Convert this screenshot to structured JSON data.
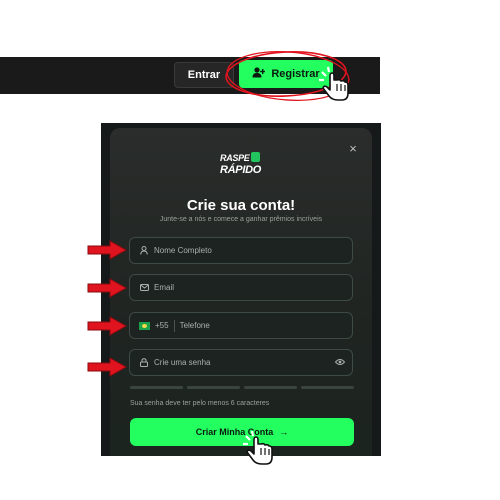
{
  "header": {
    "login_label": "Entrar",
    "register_label": "Registrar"
  },
  "modal": {
    "logo_line1": "RASPE",
    "logo_line2": "RÁPIDO",
    "close_symbol": "×",
    "title": "Crie sua conta!",
    "subtitle": "Junte-se a nós e comece a ganhar prêmios incríveis",
    "fields": {
      "name_placeholder": "Nome Completo",
      "email_placeholder": "Email",
      "phone_prefix": "+55",
      "phone_placeholder": "Telefone",
      "password_placeholder": "Crie uma senha"
    },
    "password_hint": "Sua senha deve ter pelo menos 6 caracteres",
    "submit_label": "Criar Minha Conta",
    "submit_arrow": "→"
  },
  "colors": {
    "accent_green": "#22ff5e",
    "annotation_red": "#e0141e",
    "topbar": "#1a1a1a",
    "modal_bg": "#1f2421"
  },
  "icons": [
    "user-plus-icon",
    "close-icon",
    "user-icon",
    "mail-icon",
    "brazil-flag-icon",
    "lock-icon",
    "eye-icon",
    "arrow-right-icon",
    "pointer-hand-icon",
    "red-arrow-icon"
  ]
}
